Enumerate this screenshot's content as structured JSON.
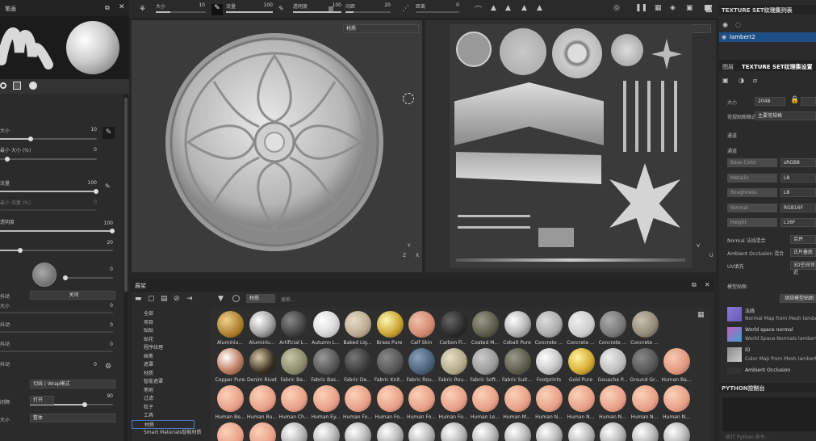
{
  "brush_panel": {
    "title": "笔画",
    "size_label": "大小",
    "size_value": "10",
    "min_size_label": "最小 大小 (%)",
    "min_size_value": "0",
    "flow_label": "流量",
    "flow_value": "100",
    "min_flow_label": "最小 流量 (%)",
    "min_flow_value": "0",
    "opacity_label": "透明度",
    "opacity_value": "100",
    "opacity_value2": "20",
    "angle_value": "0",
    "jitter_label": "抖动",
    "jitter_value": "关闭",
    "size2_label": "大小",
    "size2_value": "0",
    "p1_label": "抖动",
    "p1_value": "0",
    "p2_label": "抖动",
    "p2_value": "0",
    "p3_label": "抖动",
    "p3_value": "0",
    "wrap_select": "切线 | Wrap模式",
    "wrap_value": "90",
    "align_label": "间隔",
    "align_value": "打开",
    "size3_label": "大小",
    "size3_value": "整体"
  },
  "toolbar": {
    "size_label": "大小",
    "size_value": "10",
    "flow_label": "流量",
    "flow_value": "100",
    "alpha_label": "透明度",
    "alpha_value": "100",
    "spacing_label": "间距",
    "spacing_value": "20",
    "dist_label": "距离",
    "dist_value": "0"
  },
  "viewport": {
    "left_select": "材质",
    "right_select": "材质",
    "axis_y": "Y",
    "axis_z": "Z",
    "axis_x": "X",
    "uv_v": "V",
    "uv_u": "U"
  },
  "right_panel": {
    "list_title": "TEXTURE SET纹理集列表",
    "list_item": "lambert2",
    "tab_layers": "图层",
    "tab_settings": "TEXTURE SET纹理集设置",
    "size_label": "大小",
    "size_value": "2048",
    "normal_label": "常规贴图格式",
    "normal_value": "主要常规格",
    "channels_title": "通道",
    "channels_label": "通道",
    "ch1": "Base Color",
    "ch1v": "sRGB8",
    "ch2": "Metallic",
    "ch2v": "L8",
    "ch3": "Roughness",
    "ch3v": "L8",
    "ch4": "Normal",
    "ch4v": "RGB16F",
    "ch5": "Height",
    "ch5v": "L16F",
    "normal_mix_label": "Normal 法线混合",
    "normal_mix_value": "合并",
    "ao_label": "Ambient Occlusion 混合",
    "ao_value": "正片叠底",
    "uv_label": "UV填充",
    "uv_value": "3D空间邻近",
    "maps_title": "模型贴图",
    "bake_button": "烘焙模型贴图",
    "map1_t": "法线",
    "map1_s": "Normal Map from Mesh lambert2",
    "map2_t": "World space normal",
    "map2_s": "World Space Normals lambert2",
    "map3_t": "ID",
    "map3_s": "Color Map from Mesh lambert2",
    "map4_t": "Ambient Occlusion",
    "python_title": "PYTHON控制台",
    "python_placeholder": "执行 Python 命令..."
  },
  "shelf": {
    "title": "展架",
    "search_chip": "材质",
    "search_placeholder": "搜索...",
    "tree": [
      "全部",
      "项目",
      "贴贴",
      "贴花",
      "程序纹理",
      "画笔",
      "遮罩",
      "材质",
      "智能遮罩",
      "笔刷",
      "过滤",
      "粒子",
      "工具",
      "材质",
      "Smart Materials智能材质"
    ],
    "row1": [
      "Aluminiu...",
      "Aluminiu...",
      "Artificial L...",
      "Autumn L...",
      "Baked Lig...",
      "Brass Pure",
      "Calf Skin",
      "Carbon Fi...",
      "Coated M...",
      "Cobalt Pure",
      "Concrete ...",
      "Concrete ...",
      "Concrete ...",
      "Concrete ..."
    ],
    "row2": [
      "Copper Pure",
      "Denim Rivet",
      "Fabric Ba...",
      "Fabric Bas...",
      "Fabric De...",
      "Fabric Knit...",
      "Fabric Rou...",
      "Fabric Rou...",
      "Fabric Soft...",
      "Fabric Suit...",
      "Footprints",
      "Gold Pure",
      "Gouache P...",
      "Ground Gr...",
      "Human Ba..."
    ],
    "row3": [
      "Human Be...",
      "Human Bu...",
      "Human Ch...",
      "Human Ey...",
      "Human Fo...",
      "Human Fo...",
      "Human Fo...",
      "Human Fo...",
      "Human Le...",
      "Human M...",
      "Human N...",
      "Human N...",
      "Human N...",
      "Human N...",
      "Human N..."
    ]
  }
}
